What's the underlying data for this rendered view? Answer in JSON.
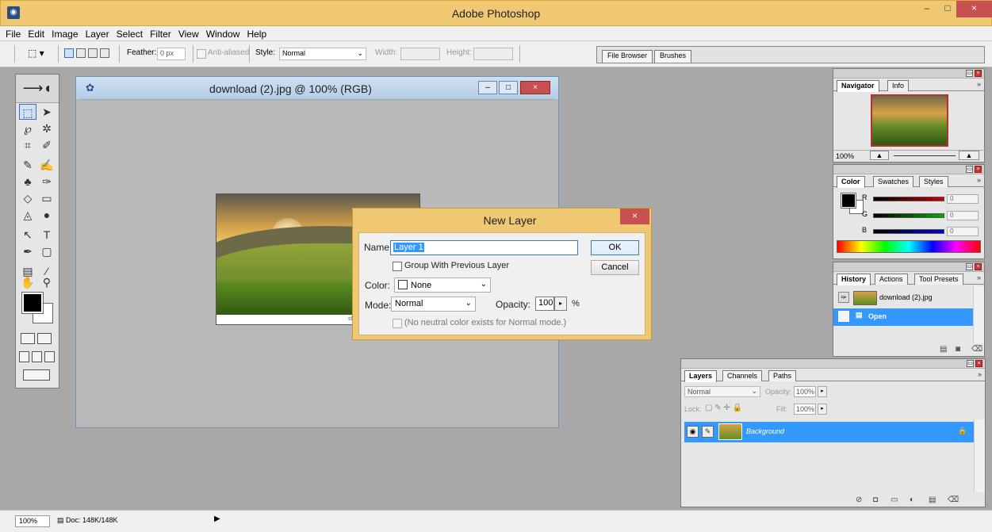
{
  "app": {
    "title": "Adobe Photoshop"
  },
  "window_controls": {
    "minimize": "–",
    "maximize": "□",
    "close": "×"
  },
  "menu": [
    "File",
    "Edit",
    "Image",
    "Layer",
    "Select",
    "Filter",
    "View",
    "Window",
    "Help"
  ],
  "options_bar": {
    "feather_label": "Feather:",
    "feather_value": "0 px",
    "anti_aliased_label": "Anti-aliased",
    "style_label": "Style:",
    "style_value": "Normal",
    "width_label": "Width:",
    "height_label": "Height:",
    "palette_tabs": [
      "File Browser",
      "Brushes"
    ]
  },
  "document": {
    "title": "download (2).jpg @ 100% (RGB)",
    "watermark": "shutterstock.com • 4070211"
  },
  "dialog": {
    "title": "New Layer",
    "name_label": "Name:",
    "name_value": "Layer 1",
    "ok_label": "OK",
    "cancel_label": "Cancel",
    "group_label": "Group With Previous Layer",
    "color_label": "Color:",
    "color_value": "None",
    "mode_label": "Mode:",
    "mode_value": "Normal",
    "opacity_label": "Opacity:",
    "opacity_value": "100",
    "opacity_unit": "%",
    "neutral_label": "(No neutral color exists for Normal mode.)"
  },
  "navigator": {
    "tabs": [
      "Navigator",
      "Info"
    ],
    "zoom": "100%"
  },
  "color_panel": {
    "tabs": [
      "Color",
      "Swatches",
      "Styles"
    ],
    "channels": [
      {
        "label": "R",
        "value": "0",
        "color": "#cc0000"
      },
      {
        "label": "G",
        "value": "0",
        "color": "#00aa00"
      },
      {
        "label": "B",
        "value": "0",
        "color": "#0000cc"
      }
    ]
  },
  "history": {
    "tabs": [
      "History",
      "Actions",
      "Tool Presets"
    ],
    "snapshot": "download (2).jpg",
    "items": [
      "Open"
    ]
  },
  "layers": {
    "tabs": [
      "Layers",
      "Channels",
      "Paths"
    ],
    "blend_mode": "Normal",
    "opacity_label": "Opacity:",
    "opacity_value": "100%",
    "lock_label": "Lock:",
    "fill_label": "Fill:",
    "fill_value": "100%",
    "layer_name": "Background"
  },
  "status": {
    "zoom": "100%",
    "doc_info": "Doc: 148K/148K"
  },
  "colors": {
    "accent_selection": "#3399ff",
    "title_bar": "#f0c873",
    "close_button": "#c75050"
  }
}
